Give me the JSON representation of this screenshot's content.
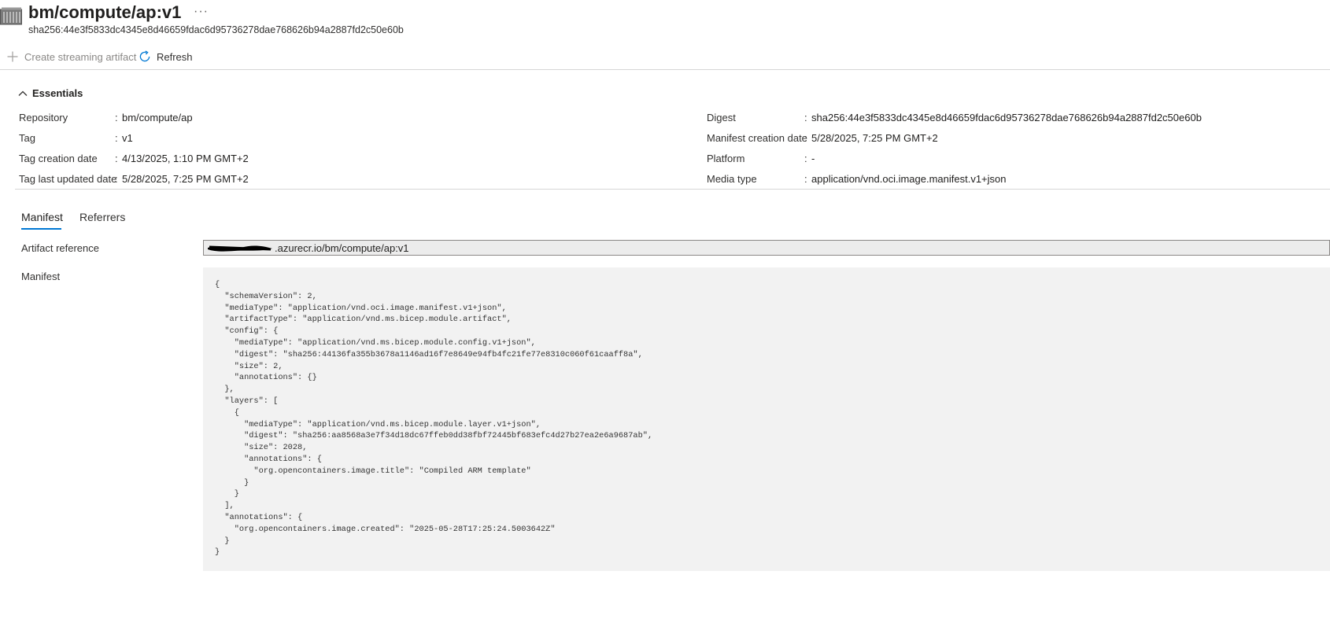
{
  "header": {
    "title": "bm/compute/ap:v1",
    "subtitle": "sha256:44e3f5833dc4345e8d46659fdac6d95736278dae768626b94a2887fd2c50e60b",
    "more_label": "···",
    "icon": "container-registry-icon"
  },
  "toolbar": {
    "create_label": "Create streaming artifact",
    "refresh_label": "Refresh"
  },
  "essentials": {
    "label": "Essentials",
    "left": [
      {
        "label": "Repository",
        "value": "bm/compute/ap"
      },
      {
        "label": "Tag",
        "value": "v1"
      },
      {
        "label": "Tag creation date",
        "value": "4/13/2025, 1:10 PM GMT+2"
      },
      {
        "label": "Tag last updated date",
        "value": "5/28/2025, 7:25 PM GMT+2"
      }
    ],
    "right": [
      {
        "label": "Digest",
        "value": "sha256:44e3f5833dc4345e8d46659fdac6d95736278dae768626b94a2887fd2c50e60b"
      },
      {
        "label": "Manifest creation date",
        "value": "5/28/2025, 7:25 PM GMT+2"
      },
      {
        "label": "Platform",
        "value": "-"
      },
      {
        "label": "Media type",
        "value": "application/vnd.oci.image.manifest.v1+json"
      }
    ],
    "separator": ":"
  },
  "tabs": [
    {
      "label": "Manifest",
      "active": true
    },
    {
      "label": "Referrers",
      "active": false
    }
  ],
  "artifact_reference": {
    "label": "Artifact reference",
    "value": ".azurecr.io/bm/compute/ap:v1"
  },
  "manifest": {
    "label": "Manifest",
    "content": "{\n  \"schemaVersion\": 2,\n  \"mediaType\": \"application/vnd.oci.image.manifest.v1+json\",\n  \"artifactType\": \"application/vnd.ms.bicep.module.artifact\",\n  \"config\": {\n    \"mediaType\": \"application/vnd.ms.bicep.module.config.v1+json\",\n    \"digest\": \"sha256:44136fa355b3678a1146ad16f7e8649e94fb4fc21fe77e8310c060f61caaff8a\",\n    \"size\": 2,\n    \"annotations\": {}\n  },\n  \"layers\": [\n    {\n      \"mediaType\": \"application/vnd.ms.bicep.module.layer.v1+json\",\n      \"digest\": \"sha256:aa8568a3e7f34d18dc67ffeb0dd38fbf72445bf683efc4d27b27ea2e6a9687ab\",\n      \"size\": 2028,\n      \"annotations\": {\n        \"org.opencontainers.image.title\": \"Compiled ARM template\"\n      }\n    }\n  ],\n  \"annotations\": {\n    \"org.opencontainers.image.created\": \"2025-05-28T17:25:24.5003642Z\"\n  }\n}"
  },
  "colors": {
    "accent": "#0078d4",
    "disabled_text": "#8a8886",
    "manifest_bg": "#f2f2f2",
    "input_bg": "#ececec"
  }
}
